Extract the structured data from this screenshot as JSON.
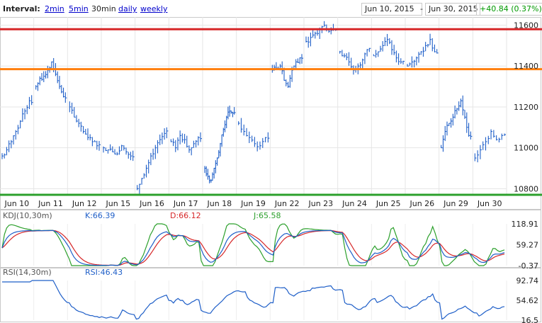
{
  "header": {
    "interval_label": "Interval:",
    "intervals": [
      {
        "label": "2min",
        "active": false
      },
      {
        "label": "5min",
        "active": false
      },
      {
        "label": "30min",
        "active": true
      },
      {
        "label": "daily",
        "active": false
      },
      {
        "label": "weekly",
        "active": false
      }
    ],
    "date_from": "Jun 10, 2015",
    "date_sep": "-",
    "date_to": "Jun 30, 2015",
    "change": "+40.84 (0.37%)",
    "change_color": "#009900"
  },
  "chart_data": [
    {
      "type": "bar",
      "subtype": "ohlc-price",
      "title": "",
      "x_labels": [
        "Jun 10",
        "Jun 11",
        "Jun 12",
        "Jun 15",
        "Jun 16",
        "Jun 17",
        "Jun 18",
        "Jun 19",
        "Jun 22",
        "Jun 23",
        "Jun 24",
        "Jun 25",
        "Jun 26",
        "Jun 29",
        "Jun 30"
      ],
      "y_ticks": [
        11600,
        11400,
        11200,
        11000,
        10800
      ],
      "ylim": [
        10770,
        11640
      ],
      "grid": true,
      "closes_per_day": {
        "Jun 10": [
          10960,
          10990,
          11030,
          11080,
          11130,
          11180,
          11230
        ],
        "Jun 11": [
          11300,
          11340,
          11350,
          11380,
          11420,
          11360,
          11300,
          11250
        ],
        "Jun 12": [
          11200,
          11150,
          11120,
          11080,
          11050,
          11030,
          11010
        ],
        "Jun 15": [
          11000,
          10990,
          10980,
          10970,
          11010,
          10980,
          10960
        ],
        "Jun 16": [
          10800,
          10850,
          10900,
          10960,
          11000,
          11040,
          11070
        ],
        "Jun 17": [
          11030,
          11000,
          11060,
          11040,
          10990,
          11020,
          11050
        ],
        "Jun 18": [
          10900,
          10860,
          10840,
          10900,
          10950,
          11020,
          11090,
          11150,
          11180,
          11170
        ],
        "Jun 19": [
          11120,
          11080,
          11050,
          11020,
          11010,
          11050
        ],
        "Jun 22": [
          11380,
          11390,
          11400,
          11330,
          11300,
          11380,
          11420,
          11440
        ],
        "Jun 23": [
          11520,
          11540,
          11560,
          11580,
          11600,
          11570,
          11580
        ],
        "Jun 24": [
          11470,
          11450,
          11420,
          11380,
          11400,
          11430,
          11480
        ],
        "Jun 25": [
          11450,
          11470,
          11500,
          11530,
          11480,
          11440,
          11420
        ],
        "Jun 26": [
          11400,
          11420,
          11440,
          11470,
          11500,
          11530,
          11470
        ],
        "Jun 29": [
          11000,
          11080,
          11120,
          11150,
          11190,
          11230,
          11150,
          11060
        ],
        "Jun 30": [
          10950,
          10990,
          11030,
          11080,
          11040,
          11060
        ]
      },
      "horizontal_lines": [
        {
          "value": 11580,
          "color": "#d62728"
        },
        {
          "value": 11385,
          "color": "#ff7f0e"
        },
        {
          "value": 10770,
          "color": "#2ca02c"
        }
      ]
    },
    {
      "type": "line",
      "title": "KDJ(10,30m)",
      "series": [
        {
          "name": "K:66.39",
          "color": "#1f5fc8"
        },
        {
          "name": "D:66.12",
          "color": "#d62728"
        },
        {
          "name": "J:65.58",
          "color": "#2ca02c"
        }
      ],
      "y_ticks": [
        "118.91",
        "59.27",
        "-0.37"
      ],
      "ylim": [
        -0.37,
        118.91
      ]
    },
    {
      "type": "line",
      "title": "RSI(14,30m)",
      "series": [
        {
          "name": "RSI:46.43",
          "color": "#1f5fc8"
        }
      ],
      "y_ticks": [
        "92.74",
        "54.62",
        "16.5"
      ],
      "ylim": [
        16.5,
        92.74
      ]
    }
  ]
}
